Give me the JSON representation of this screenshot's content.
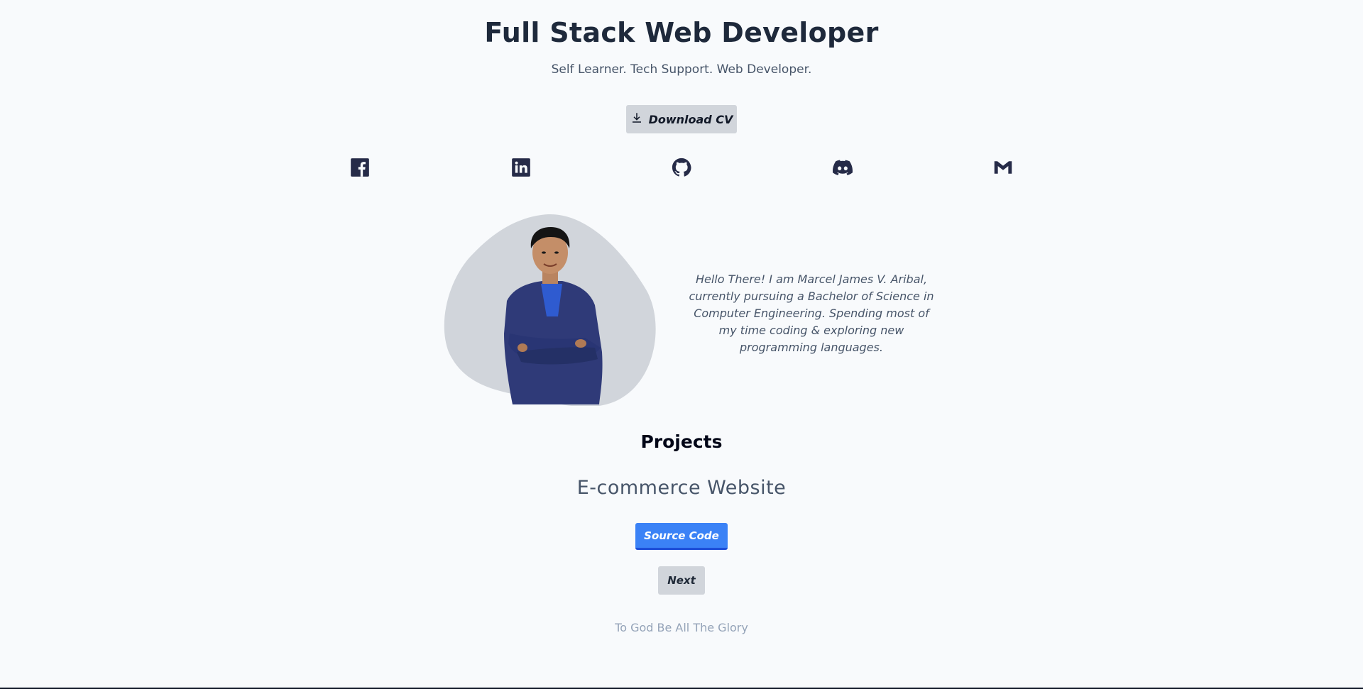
{
  "hero": {
    "headline": "Full Stack Web Developer",
    "tagline": "Self Learner. Tech Support. Web Developer.",
    "cv_button_label": "Download CV",
    "cv_icon": "download-icon"
  },
  "social": [
    {
      "name": "facebook",
      "icon": "facebook-icon"
    },
    {
      "name": "linkedin",
      "icon": "linkedin-icon"
    },
    {
      "name": "github",
      "icon": "github-icon"
    },
    {
      "name": "discord",
      "icon": "discord-icon"
    },
    {
      "name": "gmail",
      "icon": "gmail-icon"
    }
  ],
  "about": {
    "bio": "Hello There! I am Marcel James V. Aribal, currently pursuing a Bachelor of Science in Computer Engineering. Spending most of my time coding & exploring new programming languages."
  },
  "projects": {
    "title": "Projects",
    "current_name": "E-commerce Website",
    "source_label": "Source Code",
    "next_label": "Next"
  },
  "footer": {
    "text": "To God Be All The Glory"
  },
  "colors": {
    "background": "#f8fafc",
    "heading": "#1e293b",
    "icon": "#262b48",
    "accent": "#3b82f6",
    "button_gray": "#d1d5db",
    "blob": "#d1d5db"
  }
}
